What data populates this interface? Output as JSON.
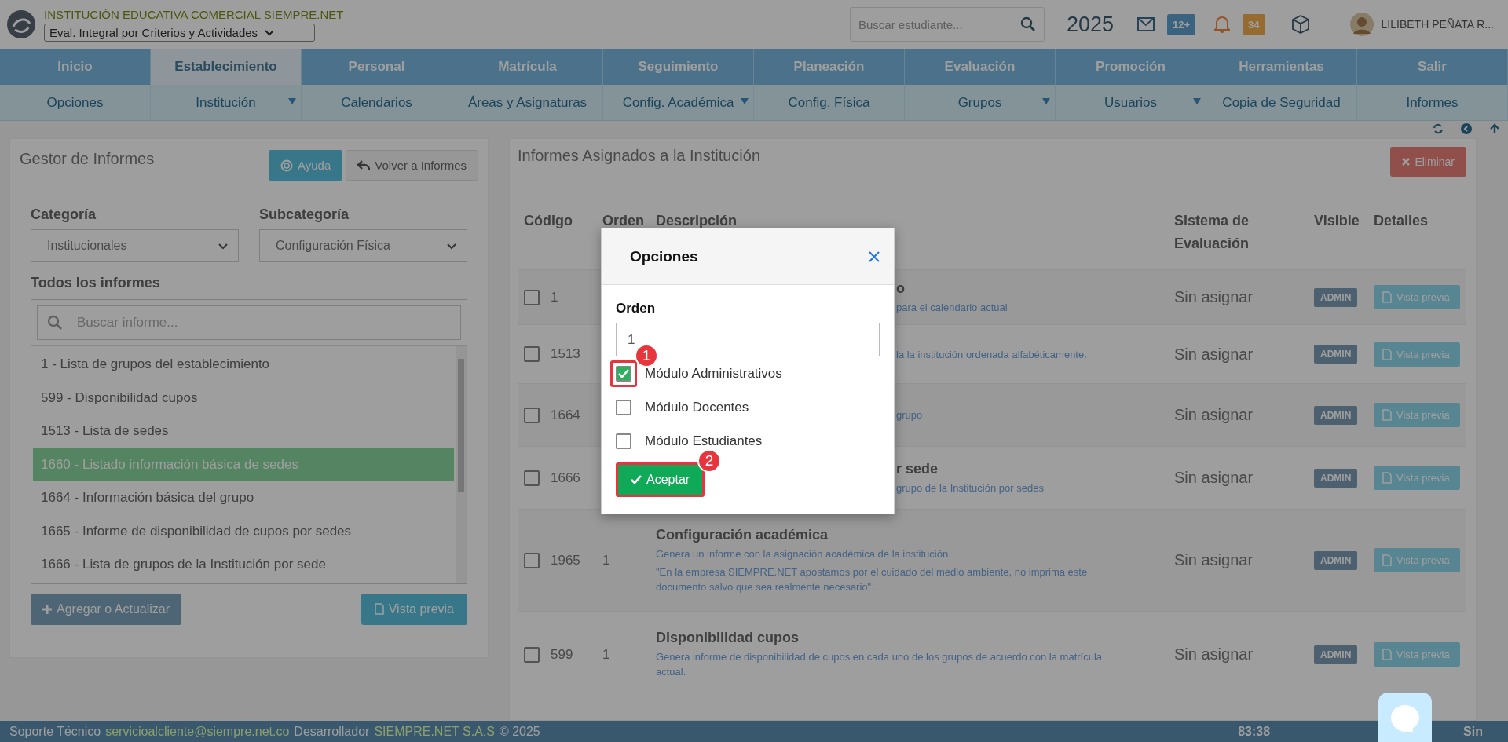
{
  "header": {
    "institution": "INSTITUCIÓN EDUCATIVA COMERCIAL SIEMPRE.NET",
    "evaluation_select": "Eval. Integral por Criterios y Actividades",
    "search": {
      "placeholder": "Buscar estudiante..."
    },
    "year": "2025",
    "messages_badge": "12+",
    "notifications_badge": "34",
    "user": "LILIBETH PEÑATA R..."
  },
  "main_nav": [
    {
      "label": "Inicio",
      "selected": false
    },
    {
      "label": "Establecimiento",
      "selected": true
    },
    {
      "label": "Personal",
      "selected": false
    },
    {
      "label": "Matrícula",
      "selected": false
    },
    {
      "label": "Seguimiento",
      "selected": false
    },
    {
      "label": "Planeación",
      "selected": false
    },
    {
      "label": "Evaluación",
      "selected": false
    },
    {
      "label": "Promoción",
      "selected": false
    },
    {
      "label": "Herramientas",
      "selected": false
    },
    {
      "label": "Salir",
      "selected": false
    }
  ],
  "sub_nav": [
    {
      "label": "Opciones",
      "has_menu": false
    },
    {
      "label": "Institución",
      "has_menu": true
    },
    {
      "label": "Calendarios",
      "has_menu": false
    },
    {
      "label": "Áreas y Asignaturas",
      "has_menu": false
    },
    {
      "label": "Config. Académica",
      "has_menu": true
    },
    {
      "label": "Config. Física",
      "has_menu": false
    },
    {
      "label": "Grupos",
      "has_menu": true
    },
    {
      "label": "Usuarios",
      "has_menu": true
    },
    {
      "label": "Copia de Seguridad",
      "has_menu": false
    },
    {
      "label": "Informes",
      "has_menu": false
    }
  ],
  "report_manager": {
    "title": "Gestor de Informes",
    "help_button": "Ayuda",
    "back_button": "Volver a Informes",
    "category": {
      "label": "Categoría",
      "value": "Institucionales"
    },
    "subcategory": {
      "label": "Subcategoría",
      "value": "Configuración Física"
    },
    "list_title": "Todos los informes",
    "search": {
      "placeholder": "Buscar informe..."
    },
    "reports": [
      {
        "label": "1 - Lista de grupos del establecimiento",
        "selected": false
      },
      {
        "label": "599 - Disponibilidad cupos",
        "selected": false
      },
      {
        "label": "1513 - Lista de sedes",
        "selected": false
      },
      {
        "label": "1660 - Listado información básica de sedes",
        "selected": true
      },
      {
        "label": "1664 - Información básica del grupo",
        "selected": false
      },
      {
        "label": "1665 - Informe de disponibilidad de cupos por sedes",
        "selected": false
      },
      {
        "label": "1666 - Lista de grupos de la Institución por sede",
        "selected": false
      }
    ],
    "add_button": "Agregar o Actualizar",
    "preview_button": "Vista previa"
  },
  "assigned_reports": {
    "title": "Informes Asignados a la Institución",
    "delete_button": "Eliminar",
    "columns": [
      "Código",
      "Orden",
      "Descripción",
      "Sistema de Evaluación",
      "Visible",
      "Detalles"
    ],
    "rows": [
      {
        "checked": false,
        "code": "1",
        "title": "o",
        "description": [
          "para el calendario actual"
        ],
        "covered": true,
        "system": "Sin asignar",
        "visible": "ADMIN",
        "details": "Vista previa"
      },
      {
        "checked": false,
        "code": "1513",
        "description": [
          "la la institución ordenada alfabéticamente."
        ],
        "covered": true,
        "system": "Sin asignar",
        "visible": "ADMIN",
        "details": "Vista previa"
      },
      {
        "checked": false,
        "code": "1664",
        "description": [
          "grupo"
        ],
        "covered": true,
        "system": "Sin asignar",
        "visible": "ADMIN",
        "details": "Vista previa"
      },
      {
        "checked": false,
        "code": "1666",
        "title": "r sede",
        "description": [
          "grupo de la Institución por sedes"
        ],
        "covered": true,
        "system": "Sin asignar",
        "visible": "ADMIN",
        "details": "Vista previa"
      },
      {
        "checked": false,
        "code": "1965",
        "order": "1",
        "title": "Configuración académica",
        "description": [
          "Genera un informe con la asignación académica de la institución.",
          "\"En la empresa SIEMPRE.NET apostamos por el cuidado del medio ambiente, no imprima este documento salvo que sea realmente necesario\"."
        ],
        "covered": false,
        "system": "Sin asignar",
        "visible": "ADMIN",
        "details": "Vista previa"
      },
      {
        "checked": false,
        "code": "599",
        "order": "1",
        "title": "Disponibilidad cupos",
        "description": [
          "Genera informe de disponibilidad de cupos en cada uno de los grupos de acuerdo con la matrícula actual."
        ],
        "covered": false,
        "system": "Sin asignar",
        "visible": "ADMIN",
        "details": "Vista previa"
      }
    ]
  },
  "modal": {
    "title": "Opciones",
    "order_label": "Orden",
    "order_value": "1",
    "options": [
      {
        "label": "Módulo Administrativos",
        "checked": true,
        "step": "1"
      },
      {
        "label": "Módulo Docentes",
        "checked": false
      },
      {
        "label": "Módulo Estudiantes",
        "checked": false
      }
    ],
    "accept_button": "Aceptar",
    "accept_step": "2"
  },
  "footer": {
    "support_label": "Soporte Técnico",
    "support_email": "servicioalcliente@siempre.net.co",
    "developer_label": "Desarrollador",
    "developer": "SIEMPRE.NET S.A.S",
    "copyright": "© 2025",
    "timer": "83:38",
    "brand": "Sin"
  }
}
